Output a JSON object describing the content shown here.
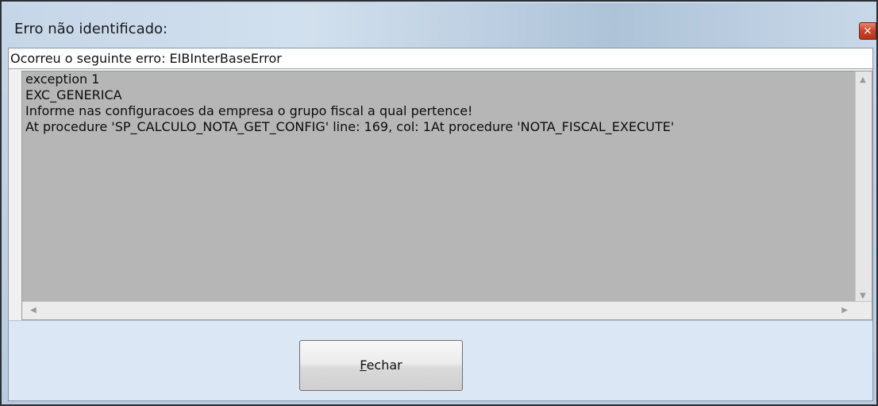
{
  "window": {
    "title": "Erro não identificado:",
    "close_glyph": "×"
  },
  "header": {
    "text": "Ocorreu o seguinte erro: EIBInterBaseError"
  },
  "memo": {
    "lines": [
      "exception 1",
      "EXC_GENERICA",
      "Informe nas configuracoes da empresa o grupo fiscal a qual pertence!",
      "At procedure 'SP_CALCULO_NOTA_GET_CONFIG' line: 169, col: 1At procedure 'NOTA_FISCAL_EXECUTE'"
    ]
  },
  "footer": {
    "close_button_label_accel": "F",
    "close_button_label_rest": "echar"
  },
  "icons": {
    "up": "scroll-up-icon",
    "down": "scroll-down-icon",
    "left": "scroll-left-icon",
    "right": "scroll-right-icon",
    "close": "close-icon"
  }
}
